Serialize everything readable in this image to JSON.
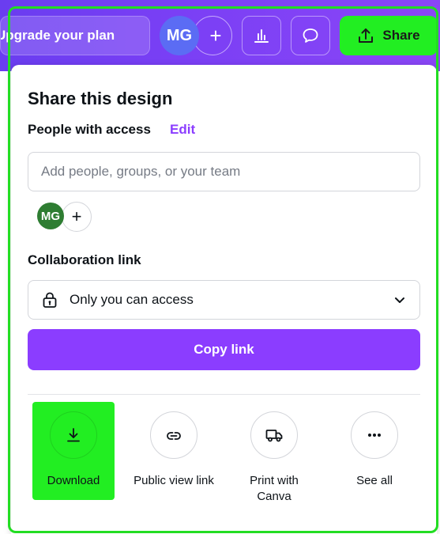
{
  "toolbar": {
    "upgrade_label": "Upgrade your plan",
    "avatar_initials": "MG",
    "add_label": "+",
    "share_label": "Share"
  },
  "panel": {
    "title": "Share this design",
    "people_label": "People with access",
    "edit_label": "Edit",
    "add_people_placeholder": "Add people, groups, or your team",
    "mini_avatar_initials": "MG",
    "mini_add_label": "+",
    "collab_label": "Collaboration link",
    "access_value": "Only you can access",
    "copy_link_label": "Copy link"
  },
  "actions": [
    {
      "label": "Download",
      "icon": "download-icon"
    },
    {
      "label": "Public view link",
      "icon": "link-icon"
    },
    {
      "label": "Print with Canva",
      "icon": "truck-icon"
    },
    {
      "label": "See all",
      "icon": "more-icon"
    }
  ],
  "colors": {
    "accent": "#8b3dff",
    "highlight": "#22ee22",
    "toolbar": "#7a3ff5"
  }
}
